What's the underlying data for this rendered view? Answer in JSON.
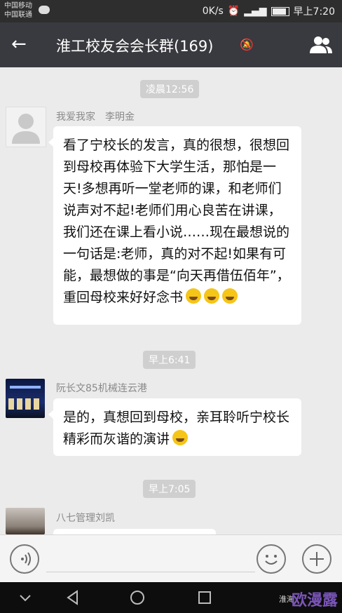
{
  "status": {
    "carrier1": "中国移动",
    "carrier2": "中国联通",
    "speed": "0K/s",
    "time_label": "早上7:20"
  },
  "header": {
    "title": "淮工校友会会长群(169)"
  },
  "messages": [
    {
      "time": "凌晨12:56",
      "sender": "我爱我家　李明金",
      "text": "看了宁校长的发言，真的很想，很想回到母校再体验下大学生活，那怕是一天!多想再听一堂老师的课，和老师们说声对不起!老师们用心良苦在讲课，我们还在课上看小说……现在最想说的一句话是:老师，真的对不起!如果有可能，最想做的事是“向天再借伍佰年”，重回母校来好好念书"
    },
    {
      "time": "早上6:41",
      "sender": "阮长文85机械连云港",
      "text": "是的，真想回到母校，亲耳聆听宁校长精彩而灰谐的演讲"
    },
    {
      "time": "早上7:05",
      "sender": "八七管理刘凯"
    }
  ],
  "watermark": {
    "small": "淮海",
    "text": "欧漫露"
  },
  "icons": [
    "back-icon",
    "mute-icon",
    "group-icon",
    "voice-icon",
    "emoji-icon",
    "plus-icon",
    "nav-back-icon",
    "nav-home-icon",
    "nav-recent-icon"
  ]
}
